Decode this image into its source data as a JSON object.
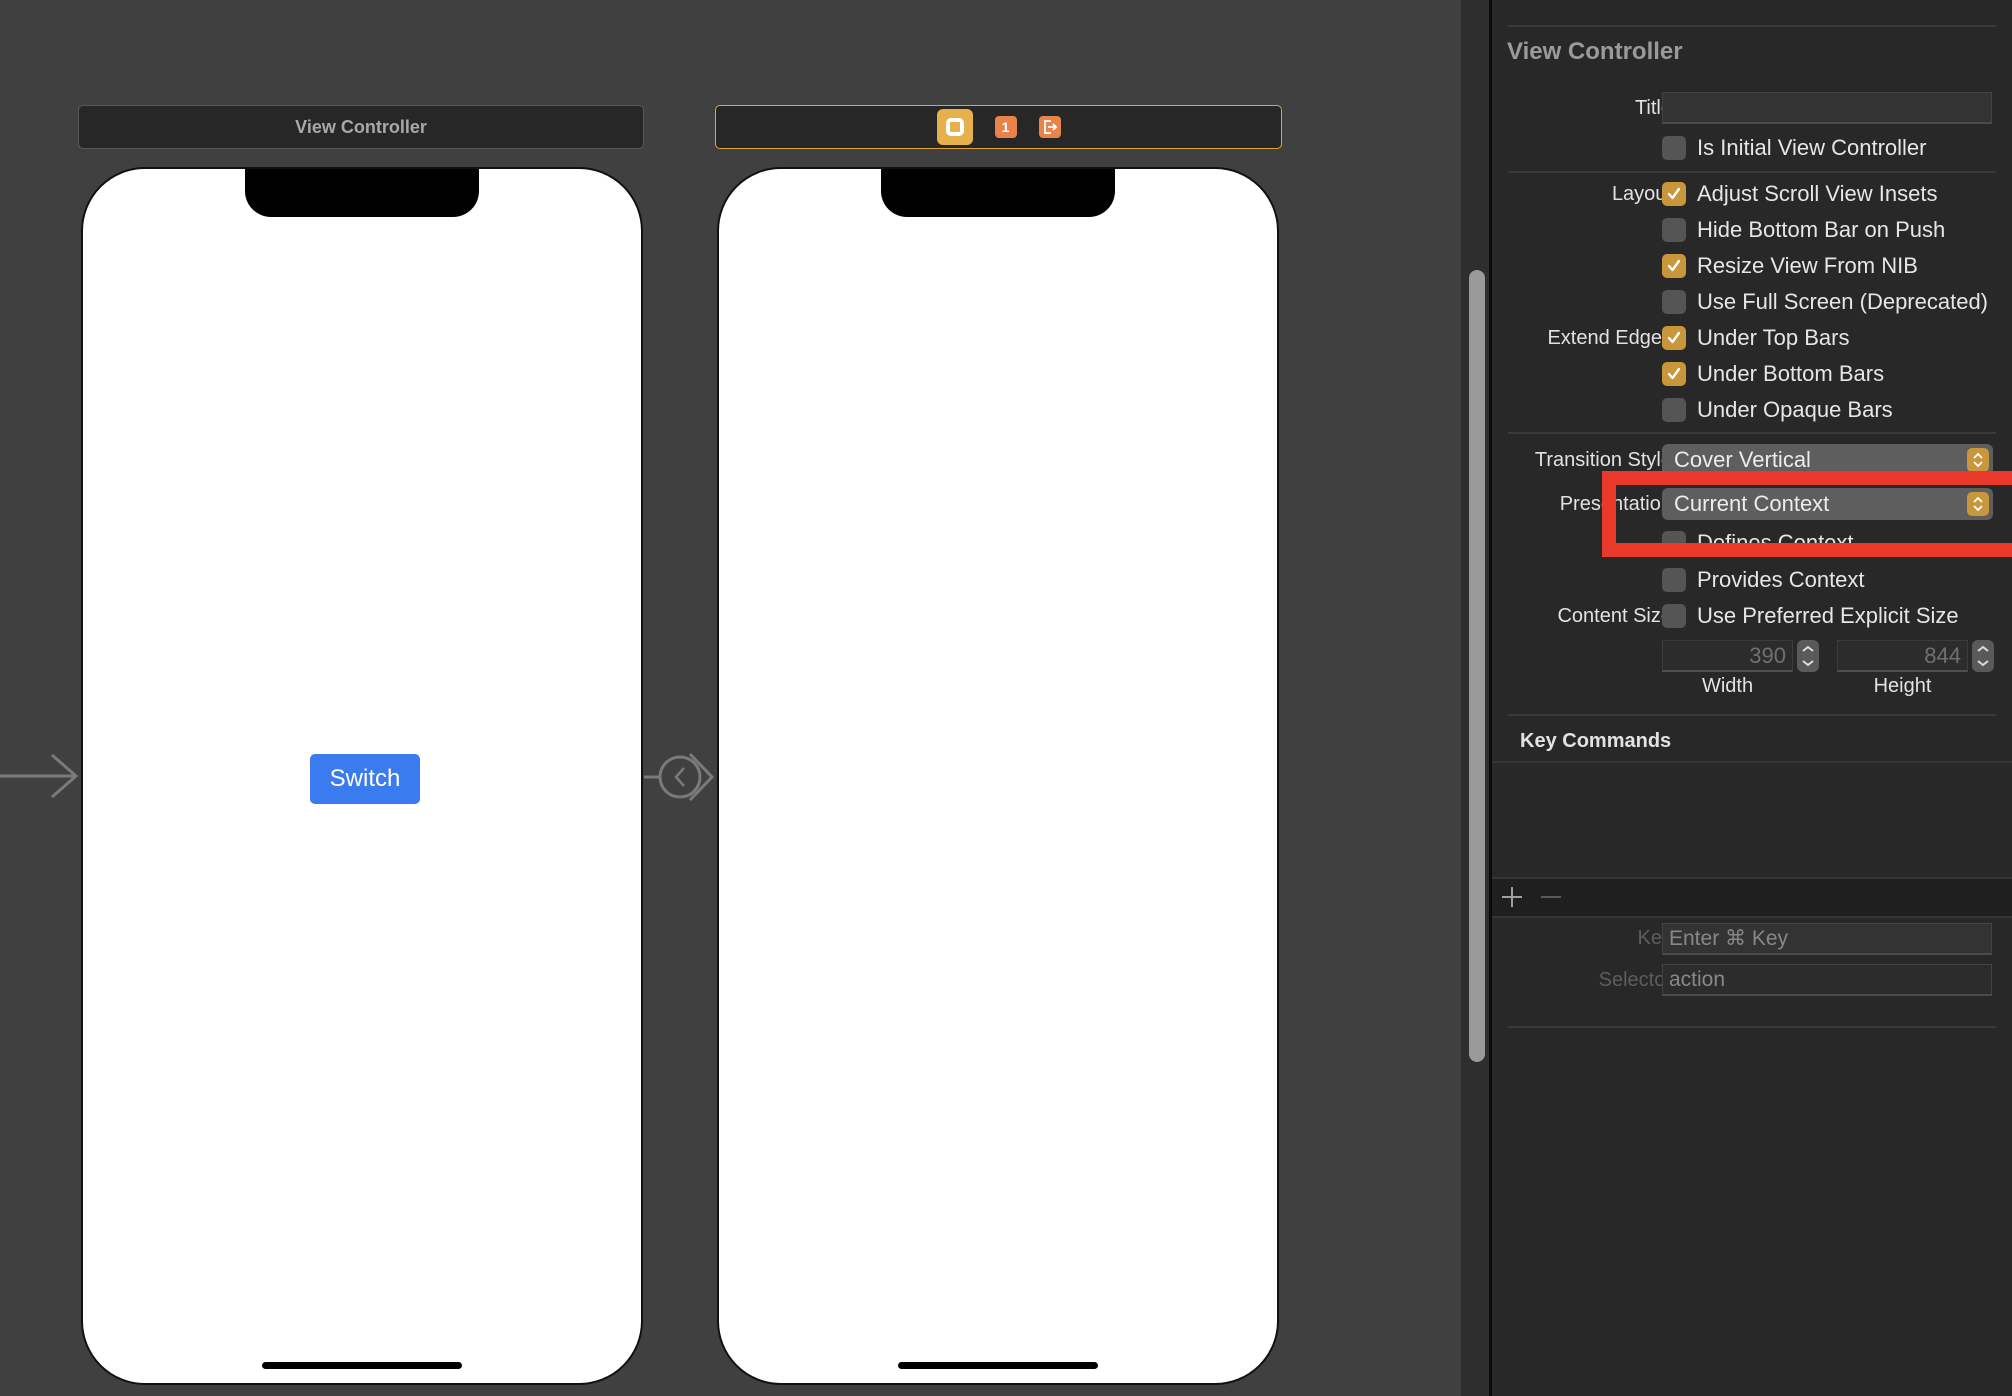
{
  "canvas": {
    "scenes": [
      {
        "header_title": "View Controller",
        "selected": false,
        "button_label": "Switch"
      },
      {
        "selected": true,
        "dock_icons": [
          "view-controller-icon",
          "first-responder-icon",
          "exit-icon"
        ],
        "first_responder_glyph": "1"
      }
    ],
    "colors": {
      "button_blue": "#3a7bf0",
      "selection_outline": "#e3a33b",
      "dock_orange": "#e8844a",
      "dock_yellow": "#e6b04c"
    }
  },
  "inspector": {
    "section_title": "View Controller",
    "title_label": "Title",
    "title_value": "",
    "is_initial": {
      "label": "Is Initial View Controller",
      "checked": false
    },
    "layout_label": "Layout",
    "layout_options": [
      {
        "label": "Adjust Scroll View Insets",
        "checked": true
      },
      {
        "label": "Hide Bottom Bar on Push",
        "checked": false
      },
      {
        "label": "Resize View From NIB",
        "checked": true
      },
      {
        "label": "Use Full Screen (Deprecated)",
        "checked": false
      }
    ],
    "extend_edges_label": "Extend Edges",
    "extend_edges_options": [
      {
        "label": "Under Top Bars",
        "checked": true
      },
      {
        "label": "Under Bottom Bars",
        "checked": true
      },
      {
        "label": "Under Opaque Bars",
        "checked": false
      }
    ],
    "transition_style_label": "Transition Style",
    "transition_style_value": "Cover Vertical",
    "presentation_label": "Presentation",
    "presentation_value": "Current Context",
    "defines_context": {
      "label": "Defines Context",
      "checked": false
    },
    "provides_context": {
      "label": "Provides Context",
      "checked": false
    },
    "content_size_label": "Content Size",
    "use_preferred_size": {
      "label": "Use Preferred Explicit Size",
      "checked": false
    },
    "width_value": "390",
    "width_caption": "Width",
    "height_value": "844",
    "height_caption": "Height",
    "key_commands_title": "Key Commands",
    "add_label": "+",
    "remove_label": "−",
    "key_label": "Key",
    "key_placeholder": "Enter ⌘ Key",
    "selector_label": "Selector",
    "selector_value": "action",
    "accent_color": "#c8963b"
  },
  "annotation": {
    "color": "#e8392a",
    "target": "presentation-popup"
  }
}
